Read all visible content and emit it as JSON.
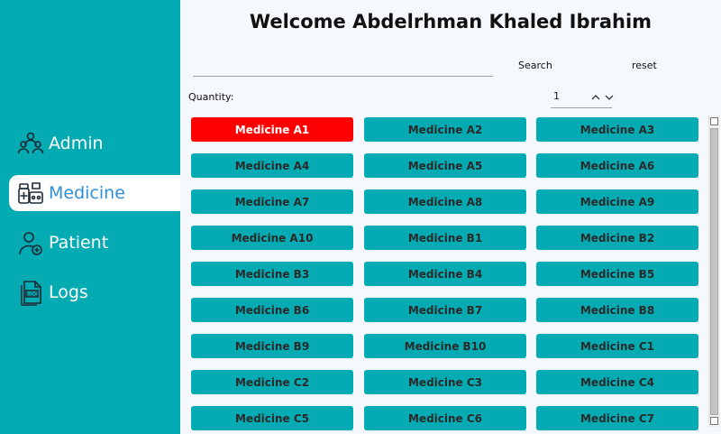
{
  "app": {
    "welcome": "Welcome Abdelrhman Khaled Ibrahim"
  },
  "sidebar": {
    "items": [
      {
        "label": "Admin",
        "icon": "admin-group-icon"
      },
      {
        "label": "Medicine",
        "icon": "medicine-icon",
        "active": true
      },
      {
        "label": "Patient",
        "icon": "patient-icon"
      },
      {
        "label": "Logs",
        "icon": "log-icon"
      }
    ]
  },
  "search": {
    "value": "",
    "search_label": "Search",
    "reset_label": "reset"
  },
  "quantity": {
    "label": "Quantity:",
    "value": "1"
  },
  "medicines": [
    "Medicine A1",
    "Medicine A2",
    "Medicine A3",
    "Medicine A4",
    "Medicine A5",
    "Medicine A6",
    "Medicine A7",
    "Medicine A8",
    "Medicine A9",
    "Medicine A10",
    "Medicine B1",
    "Medicine B2",
    "Medicine B3",
    "Medicine B4",
    "Medicine B5",
    "Medicine B6",
    "Medicine B7",
    "Medicine B8",
    "Medicine B9",
    "Medicine B10",
    "Medicine C1",
    "Medicine C2",
    "Medicine C3",
    "Medicine C4",
    "Medicine C5",
    "Medicine C6",
    "Medicine C7"
  ],
  "selected_medicine": "Medicine A1",
  "colors": {
    "sidebar": "#05abb2",
    "button": "#05abb2",
    "selected": "#ff0000",
    "active_text": "#2f8fd8"
  }
}
